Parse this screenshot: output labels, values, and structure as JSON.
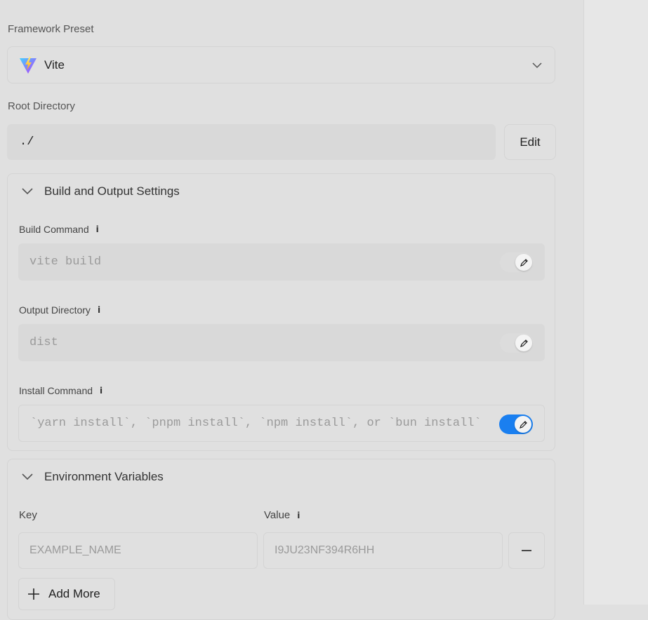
{
  "framework": {
    "label": "Framework Preset",
    "selected": "Vite",
    "logo_icon": "vite-logo-icon"
  },
  "root": {
    "label": "Root Directory",
    "value": "./",
    "edit_label": "Edit"
  },
  "build": {
    "title": "Build and Output Settings",
    "build_command": {
      "label": "Build Command",
      "placeholder": "vite build",
      "override": false
    },
    "output_directory": {
      "label": "Output Directory",
      "placeholder": "dist",
      "override": false
    },
    "install_command": {
      "label": "Install Command",
      "placeholder": "`yarn install`, `pnpm install`, `npm install`, or `bun install`",
      "override": true
    }
  },
  "env": {
    "title": "Environment Variables",
    "key_label": "Key",
    "value_label": "Value",
    "key_placeholder": "EXAMPLE_NAME",
    "value_placeholder": "I9JU23NF394R6HH",
    "add_more_label": "Add More"
  },
  "colors": {
    "accent": "#1a7ff0",
    "background": "#e0e0e0"
  }
}
